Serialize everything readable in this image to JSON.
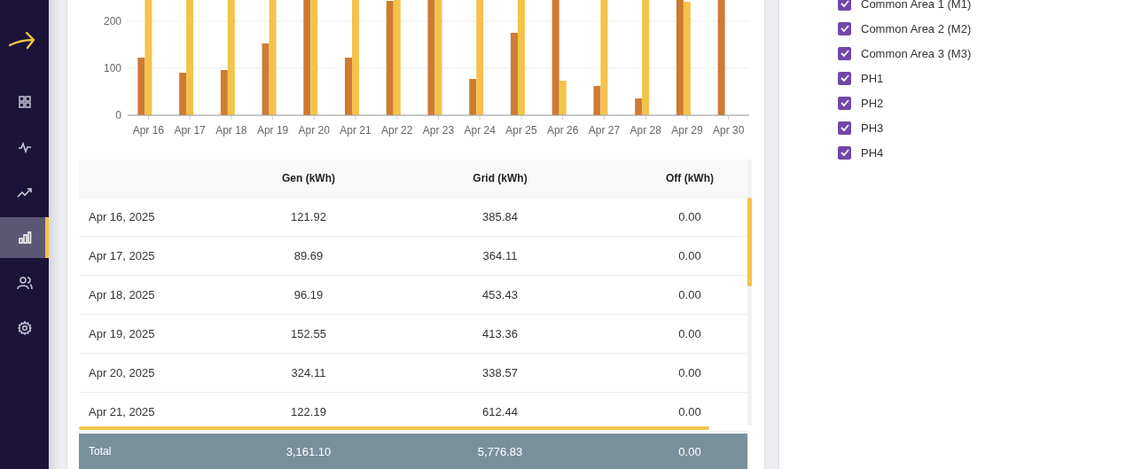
{
  "sidebar": {
    "items": [
      {
        "selected": false
      },
      {
        "selected": false
      },
      {
        "selected": false
      },
      {
        "selected": true
      },
      {
        "selected": false
      },
      {
        "selected": false
      }
    ]
  },
  "chart": {
    "x_labels": [
      "Apr 16",
      "Apr 17",
      "Apr 18",
      "Apr 19",
      "Apr 20",
      "Apr 21",
      "Apr 22",
      "Apr 23",
      "Apr 24",
      "Apr 25",
      "Apr 26",
      "Apr 27",
      "Apr 28",
      "Apr 29",
      "Apr 30"
    ],
    "y_labels": [
      "200",
      "100",
      "0"
    ]
  },
  "table": {
    "columns": [
      "",
      "Gen (kWh)",
      "Grid (kWh)",
      "Off (kWh)"
    ],
    "rows": [
      [
        "Apr 16, 2025",
        "121.92",
        "385.84",
        "0.00"
      ],
      [
        "Apr 17, 2025",
        "89.69",
        "364.11",
        "0.00"
      ],
      [
        "Apr 18, 2025",
        "96.19",
        "453.43",
        "0.00"
      ],
      [
        "Apr 19, 2025",
        "152.55",
        "413.36",
        "0.00"
      ],
      [
        "Apr 20, 2025",
        "324.11",
        "338.57",
        "0.00"
      ],
      [
        "Apr 21, 2025",
        "122.19",
        "612.44",
        "0.00"
      ]
    ],
    "total": [
      "Total",
      "3,161.10",
      "5,776.83",
      "0.00"
    ]
  },
  "meters": [
    {
      "label": "Common Area 1 (M1)",
      "checked": true
    },
    {
      "label": "Common Area 2 (M2)",
      "checked": true
    },
    {
      "label": "Common Area 3 (M3)",
      "checked": true
    },
    {
      "label": "PH1",
      "checked": true
    },
    {
      "label": "PH2",
      "checked": true
    },
    {
      "label": "PH3",
      "checked": true
    },
    {
      "label": "PH4",
      "checked": true
    }
  ]
}
